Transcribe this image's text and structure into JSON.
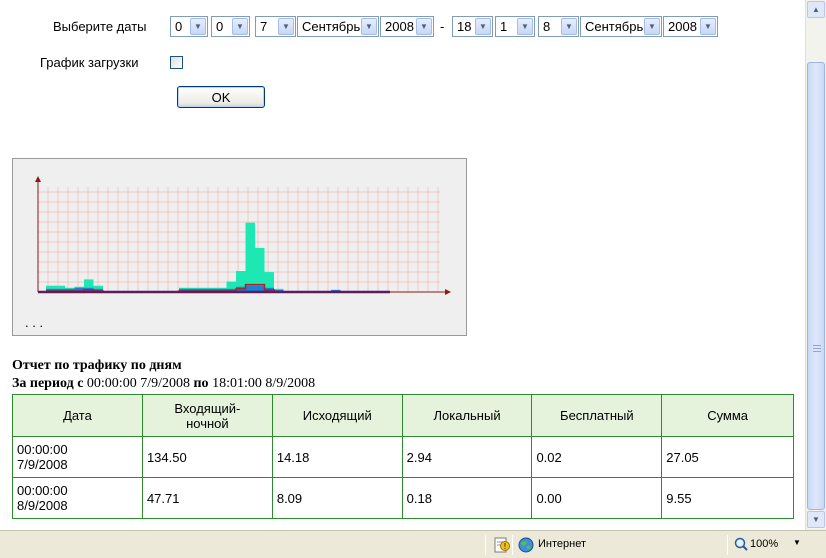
{
  "form": {
    "dates_label": "Выберите даты",
    "from": {
      "hour": "0",
      "minute": "0",
      "day": "7",
      "month": "Сентябрь",
      "year": "2008"
    },
    "dash": "-",
    "to": {
      "hour": "18",
      "minute": "1",
      "day": "8",
      "month": "Сентябрь",
      "year": "2008"
    },
    "load_chart_label": "График загрузки",
    "load_chart_checked": false,
    "ok_label": "OK"
  },
  "chart": {
    "dots": ". . .",
    "colors": {
      "incoming": "#1de8b4",
      "outgoing": "#1c7fd0",
      "local": "#b02020",
      "line": "#3a1f8c",
      "axis": "#8b1a1a",
      "grid": "#f2a0a0"
    },
    "bins": 36,
    "incoming": [
      0.06,
      0.06,
      0.04,
      0.05,
      0.12,
      0.06,
      0,
      0,
      0,
      0,
      0,
      0,
      0,
      0,
      0.04,
      0.04,
      0.04,
      0.04,
      0.04,
      0.1,
      0.2,
      0.66,
      0.42,
      0.19,
      0.03,
      0,
      0,
      0,
      0,
      0,
      0.02,
      0,
      0,
      0,
      0,
      0
    ],
    "outgoing": [
      0.03,
      0.03,
      0.03,
      0.04,
      0.04,
      0.03,
      0,
      0,
      0,
      0,
      0,
      0,
      0,
      0,
      0.03,
      0.03,
      0.03,
      0.03,
      0.03,
      0.03,
      0.05,
      0.06,
      0.06,
      0.04,
      0.02,
      0,
      0,
      0,
      0,
      0,
      0.02,
      0,
      0,
      0,
      0,
      0
    ],
    "local": [
      0.01,
      0.01,
      0.01,
      0.01,
      0.02,
      0.01,
      0,
      0,
      0,
      0,
      0,
      0,
      0,
      0,
      0.01,
      0.01,
      0.01,
      0.01,
      0.01,
      0.01,
      0.03,
      0.07,
      0.07,
      0.02,
      0,
      0,
      0,
      0,
      0,
      0,
      0,
      0,
      0,
      0,
      0,
      0
    ]
  },
  "report": {
    "title": "Отчет по трафику по дням",
    "period_prefix": "За период с",
    "period_from": "00:00:00 7/9/2008",
    "period_mid": "по",
    "period_to": "18:01:00 8/9/2008",
    "columns": [
      "Дата",
      "Входящий-ночной",
      "Исходящий",
      "Локальный",
      "Бесплатный",
      "Сумма"
    ],
    "rows": [
      [
        "00:00:00 7/9/2008",
        "134.50",
        "14.18",
        "2.94",
        "0.02",
        "27.05"
      ],
      [
        "00:00:00 8/9/2008",
        "47.71",
        "8.09",
        "0.18",
        "0.00",
        "9.55"
      ]
    ]
  },
  "statusbar": {
    "zone": "Интернет",
    "zoom": "100%",
    "icons": [
      "page-icon",
      "security-warning-icon",
      "globe-icon",
      "zoom-icon"
    ]
  }
}
